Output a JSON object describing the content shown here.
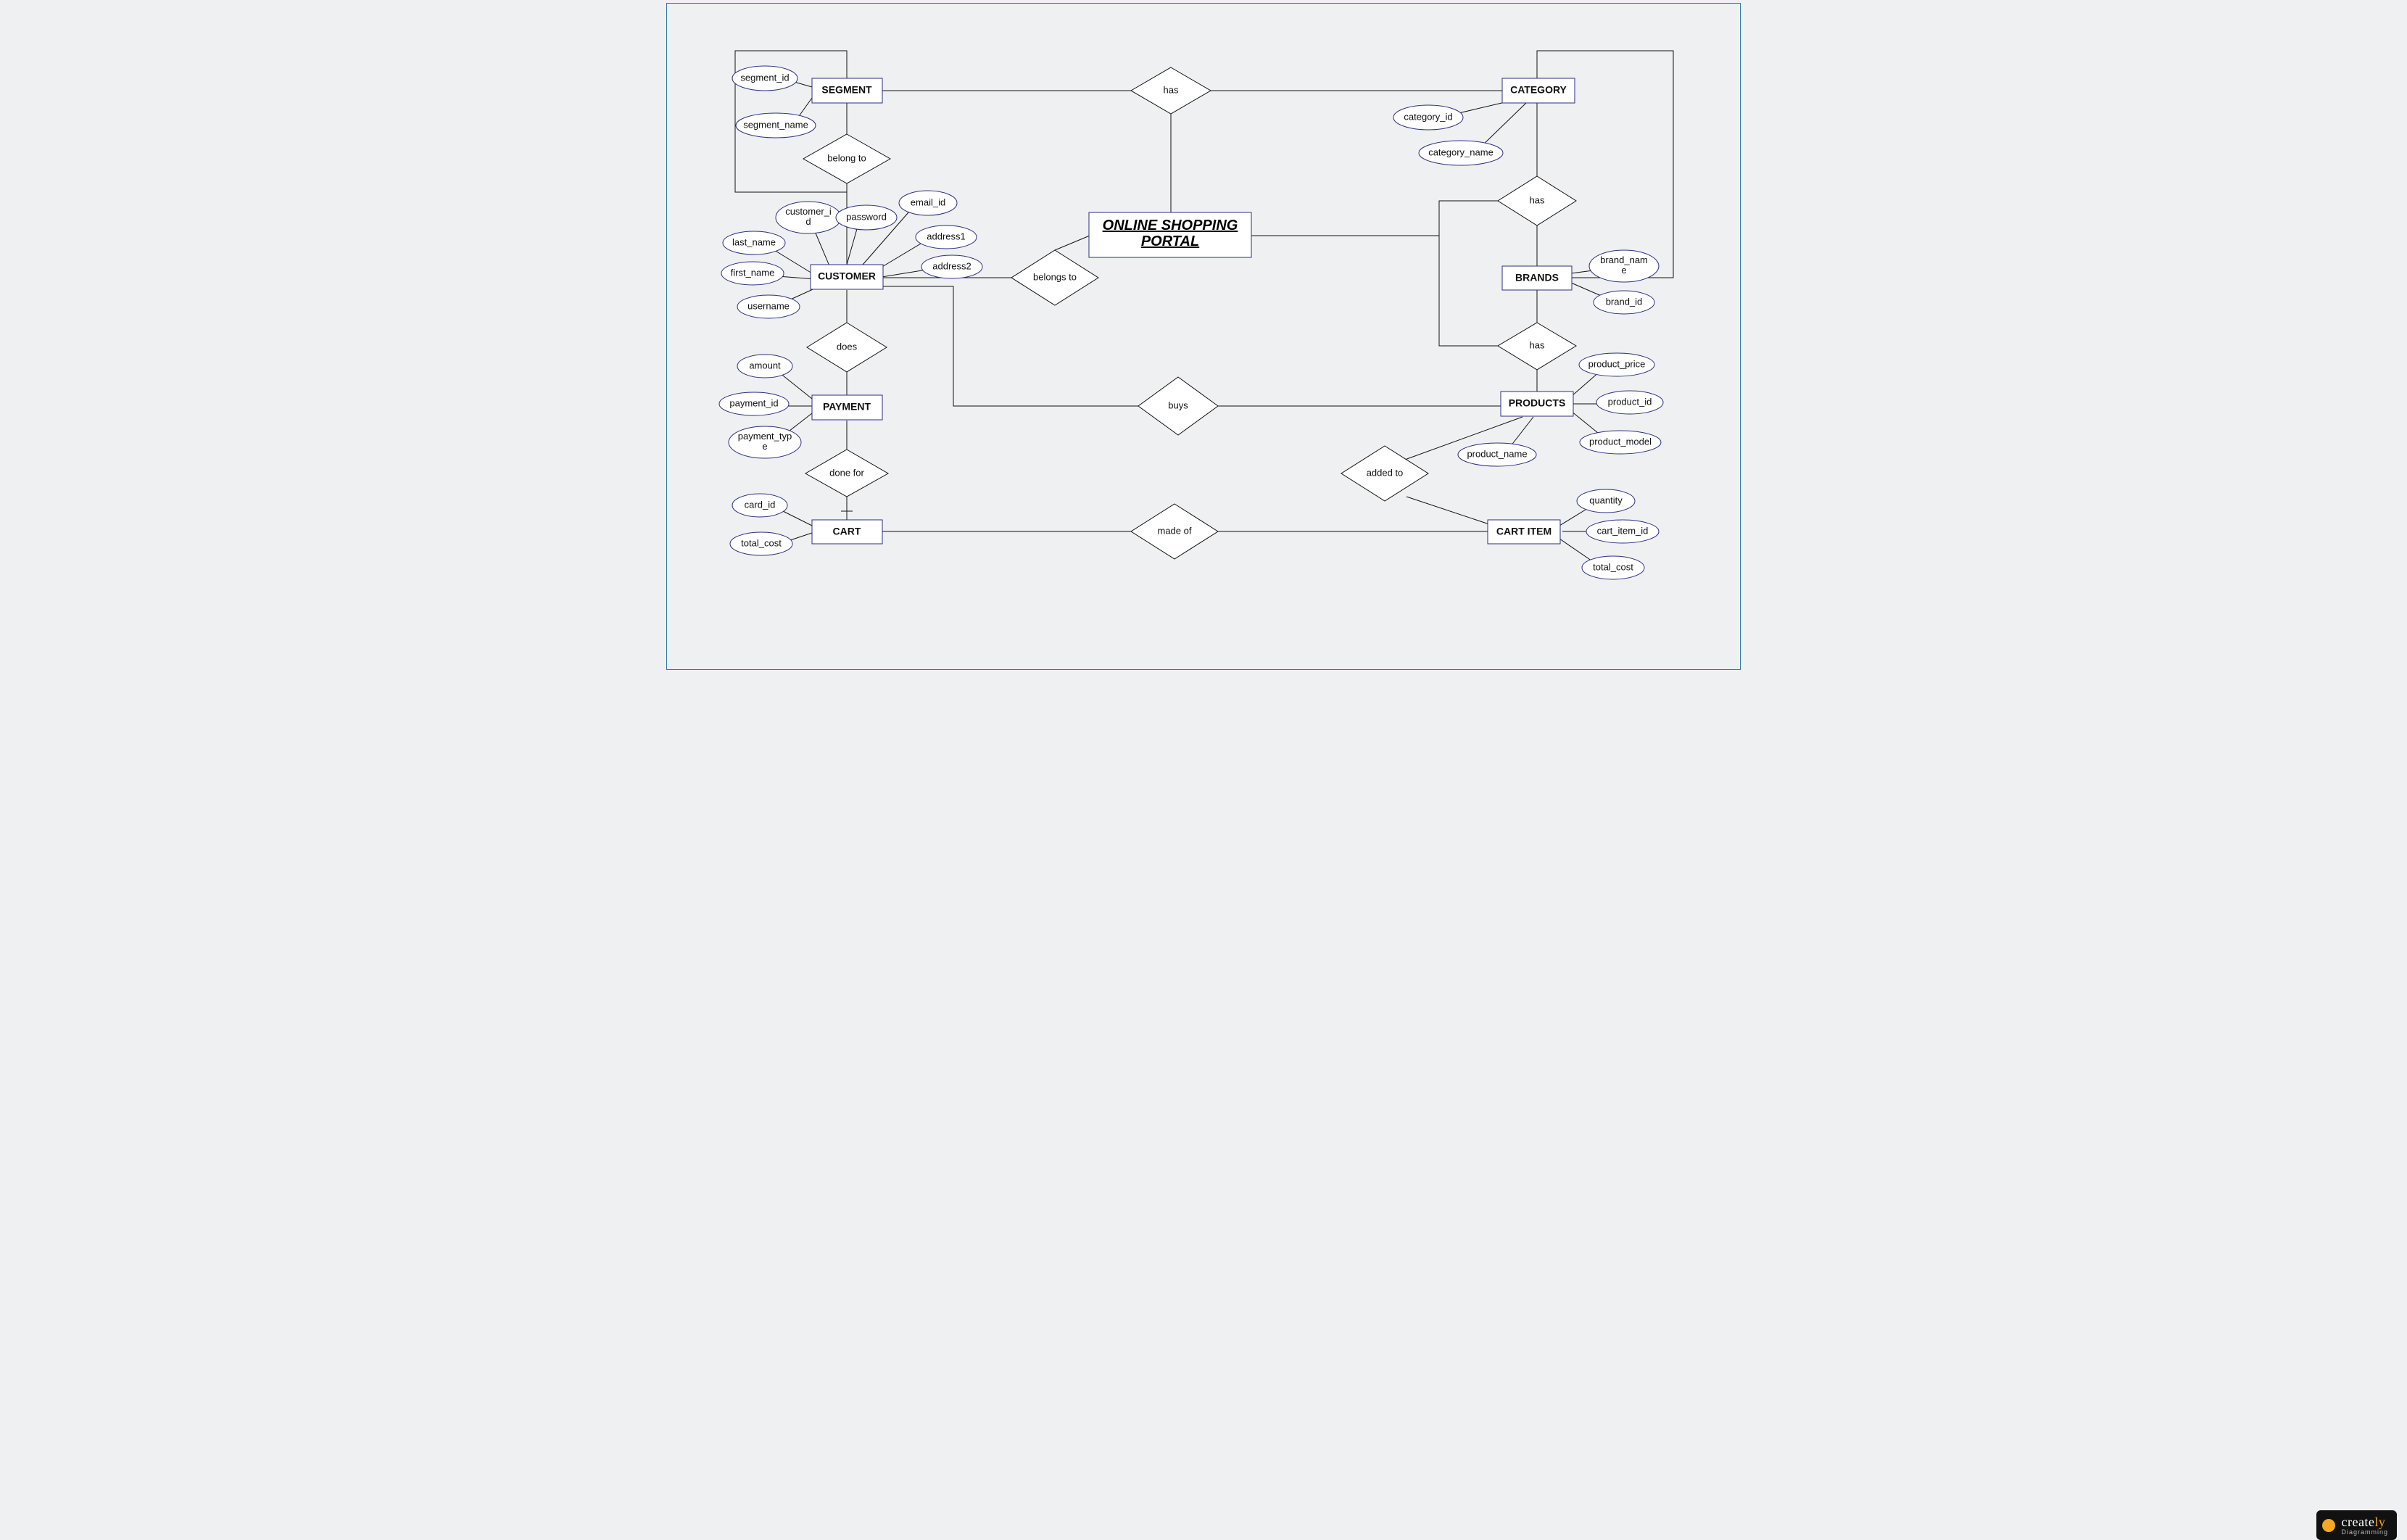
{
  "diagram_title": "ONLINE SHOPPING PORTAL",
  "logo": {
    "brand": "create",
    "brand_accent": "ly",
    "tagline": "Diagramming"
  },
  "entities": {
    "segment": "SEGMENT",
    "category": "CATEGORY",
    "brands": "BRANDS",
    "customer": "CUSTOMER",
    "payment": "PAYMENT",
    "cart": "CART",
    "products": "PRODUCTS",
    "cart_item": "CART ITEM"
  },
  "portal_box": "ONLINE SHOPPING",
  "portal_box2": "PORTAL",
  "relationships": {
    "has_top": "has",
    "belong_to": "belong to",
    "has_cat_brand": "has",
    "belongs_to": "belongs to",
    "does": "does",
    "has_brand_prod": "has",
    "buys": "buys",
    "done_for": "done for",
    "added_to": "added to",
    "made_of": "made of"
  },
  "attributes": {
    "segment_id": "segment_id",
    "segment_name": "segment_name",
    "category_id": "category_id",
    "category_name": "category_name",
    "customer_id": "customer_i\nd",
    "password": "password",
    "email_id": "email_id",
    "last_name": "last_name",
    "address1": "address1",
    "first_name": "first_name",
    "address2": "address2",
    "username": "username",
    "brand_name": "brand_nam\ne",
    "brand_id": "brand_id",
    "amount": "amount",
    "payment_id": "payment_id",
    "payment_type": "payment_typ\ne",
    "product_price": "product_price",
    "product_id": "product_id",
    "product_model": "product_model",
    "product_name": "product_name",
    "card_id": "card_id",
    "total_cost_cart": "total_cost",
    "quantity": "quantity",
    "cart_item_id": "cart_item_id",
    "total_cost_item": "total_cost"
  }
}
